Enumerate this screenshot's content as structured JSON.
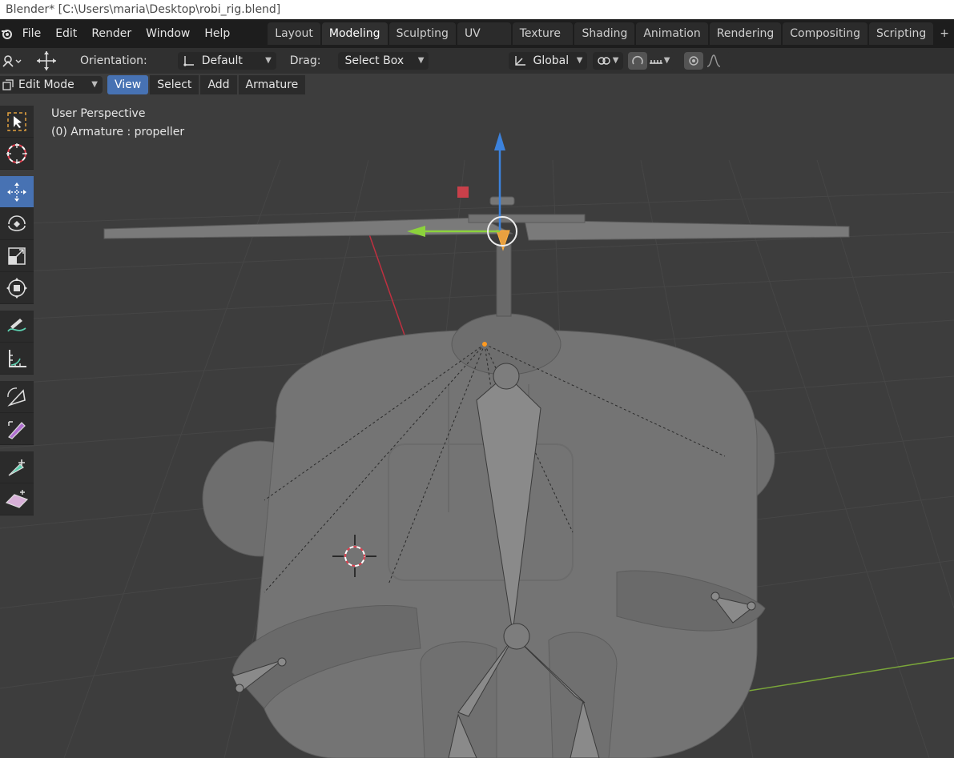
{
  "window": {
    "title": "Blender* [C:\\Users\\maria\\Desktop\\robi_rig.blend]"
  },
  "menu": [
    "File",
    "Edit",
    "Render",
    "Window",
    "Help"
  ],
  "workspaces": [
    "Layout",
    "Modeling",
    "Sculpting",
    "UV Editing",
    "Texture Paint",
    "Shading",
    "Animation",
    "Rendering",
    "Compositing",
    "Scripting"
  ],
  "active_workspace": "Modeling",
  "toolheader": {
    "orientation_label": "Orientation:",
    "orientation_value": "Default",
    "drag_label": "Drag:",
    "drag_value": "Select Box",
    "transform_orientation": "Global"
  },
  "modeheader": {
    "mode": "Edit Mode",
    "view": "View",
    "select": "Select",
    "add": "Add",
    "armature": "Armature"
  },
  "viewport": {
    "perspective": "User Perspective",
    "object_info": "(0) Armature : propeller"
  },
  "tools": [
    "select-box-icon",
    "cursor-icon",
    "move-icon",
    "rotate-icon",
    "scale-icon",
    "transform-icon",
    "annotate-icon",
    "measure-icon",
    "roll-icon",
    "bone-size-icon",
    "extrude-icon",
    "shear-icon"
  ],
  "colors": {
    "accent": "#4772b3",
    "viewport_bg": "#3d3d3d",
    "axis_x": "#e04050",
    "axis_y": "#8cd23c",
    "axis_z": "#3c82dc"
  }
}
